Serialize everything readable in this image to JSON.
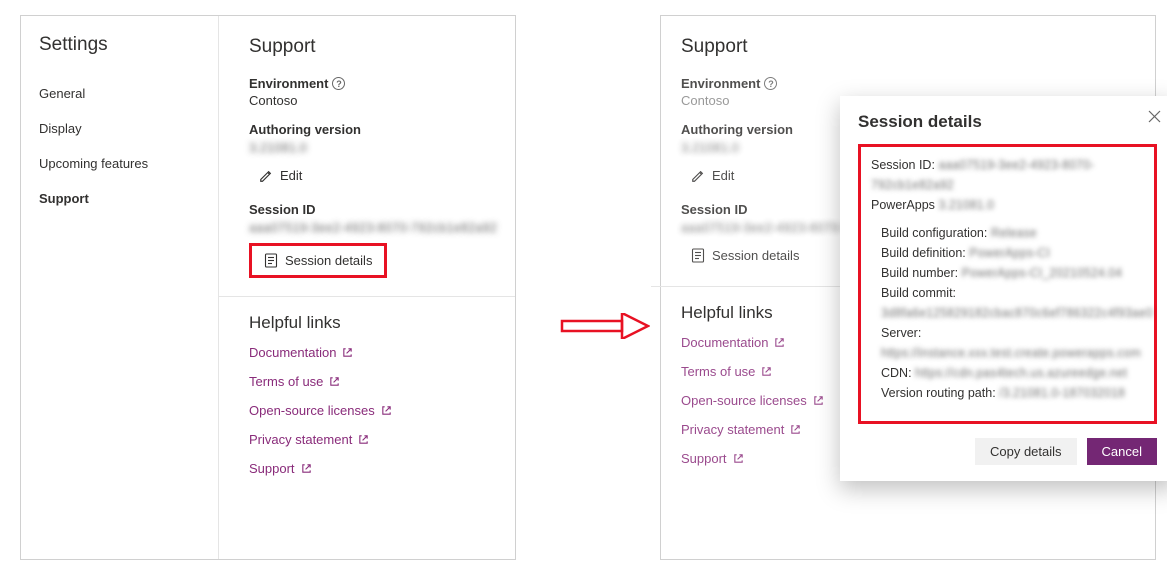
{
  "settings_title": "Settings",
  "nav": {
    "general": "General",
    "display": "Display",
    "upcoming": "Upcoming features",
    "support": "Support"
  },
  "support": {
    "heading": "Support",
    "environment_label": "Environment",
    "environment_value": "Contoso",
    "authoring_label": "Authoring version",
    "authoring_value": "3.21081.0",
    "edit_label": "Edit",
    "session_id_label": "Session ID",
    "session_id_value": "aaa07519-3ee2-4923-8070-792cb1e82a92",
    "session_details_btn": "Session details",
    "helpful_heading": "Helpful links",
    "links": {
      "documentation": "Documentation",
      "terms": "Terms of use",
      "oss": "Open-source licenses",
      "privacy": "Privacy statement",
      "support": "Support"
    }
  },
  "dialog": {
    "title": "Session details",
    "session_id_label": "Session ID:",
    "session_id_value": "aaa07519-3ee2-4923-8070-792cb1e82a92",
    "powerapps_label": "PowerApps",
    "powerapps_value": "3.21081.0",
    "build_configuration_label": "Build configuration:",
    "build_configuration_value": "Release",
    "build_definition_label": "Build definition:",
    "build_definition_value": "PowerApps-CI",
    "build_number_label": "Build number:",
    "build_number_value": "PowerApps-CI_20210524.04",
    "build_commit_label": "Build commit:",
    "build_commit_value": "3d8fa6e125829182cbac870c6ef786322c4f93ae0",
    "server_label": "Server:",
    "server_value": "https://instance.xxx.test.create.powerapps.com",
    "cdn_label": "CDN:",
    "cdn_value": "https://cdn.pas4tech.us.azureedge.net",
    "version_path_label": "Version routing path:",
    "version_path_value": "/3.21081.0-187032018",
    "copy_btn": "Copy details",
    "cancel_btn": "Cancel"
  }
}
